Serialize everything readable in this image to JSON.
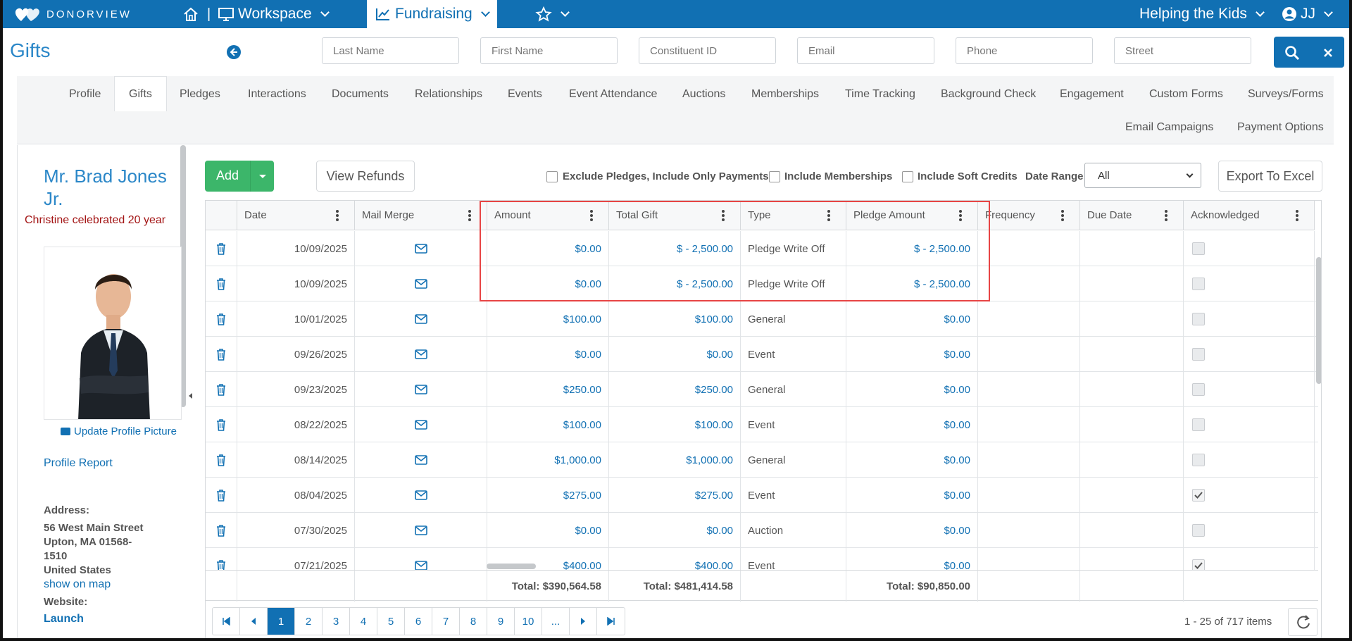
{
  "topbar": {
    "logo_text": "DONORVIEW",
    "workspace_label": "Workspace",
    "fundraising_label": "Fundraising",
    "org_label": "Helping the Kids",
    "user_initials": "JJ",
    "icons": {
      "home": "home-icon",
      "workspace": "monitor-icon",
      "fundraising": "trend-chart-icon",
      "favorites": "star-icon",
      "user": "user-circle-icon"
    }
  },
  "page": {
    "title": "Gifts"
  },
  "search": {
    "last_name": "Last Name",
    "first_name": "First Name",
    "constituent_id": "Constituent ID",
    "email": "Email",
    "phone": "Phone",
    "street": "Street"
  },
  "tabs": [
    "Profile",
    "Gifts",
    "Pledges",
    "Interactions",
    "Documents",
    "Relationships",
    "Events",
    "Event Attendance",
    "Auctions",
    "Memberships",
    "Time Tracking",
    "Background Check",
    "Engagement",
    "Custom Forms",
    "Surveys/Forms",
    "Email Campaigns",
    "Payment Options"
  ],
  "selected_tab": "Gifts",
  "profile": {
    "name_line1": "Mr. Brad Jones",
    "name_line2": "Jr.",
    "message": "Christine celebrated 20 year",
    "update_picture": "Update Profile Picture",
    "profile_report": "Profile Report",
    "address_label": "Address:",
    "address_line1": "56 West Main Street",
    "address_line2": "Upton, MA 01568-",
    "address_line3": "1510",
    "address_line4": "United States",
    "show_on_map": "show on map",
    "website_label": "Website:",
    "website_link": "Launch"
  },
  "toolbar": {
    "add": "Add",
    "view_refunds": "View Refunds",
    "exclude_pledges": "Exclude Pledges, Include Only Payments",
    "include_memberships": "Include Memberships",
    "include_soft_credits": "Include Soft Credits",
    "date_range_label": "Date Range",
    "date_range_value": "All",
    "export": "Export To Excel"
  },
  "grid": {
    "headers": [
      "Date",
      "Mail Merge",
      "Amount",
      "Total Gift",
      "Type",
      "Pledge Amount",
      "Frequency",
      "Due Date",
      "Acknowledged"
    ],
    "rows": [
      {
        "date": "10/09/2025",
        "amount": "$0.00",
        "total": "$ - 2,500.00",
        "type": "Pledge Write Off",
        "pledge": "$ - 2,500.00",
        "ack": false
      },
      {
        "date": "10/09/2025",
        "amount": "$0.00",
        "total": "$ - 2,500.00",
        "type": "Pledge Write Off",
        "pledge": "$ - 2,500.00",
        "ack": false
      },
      {
        "date": "10/01/2025",
        "amount": "$100.00",
        "total": "$100.00",
        "type": "General",
        "pledge": "$0.00",
        "ack": false
      },
      {
        "date": "09/26/2025",
        "amount": "$0.00",
        "total": "$0.00",
        "type": "Event",
        "pledge": "$0.00",
        "ack": false
      },
      {
        "date": "09/23/2025",
        "amount": "$250.00",
        "total": "$250.00",
        "type": "General",
        "pledge": "$0.00",
        "ack": false
      },
      {
        "date": "08/22/2025",
        "amount": "$100.00",
        "total": "$100.00",
        "type": "Event",
        "pledge": "$0.00",
        "ack": false
      },
      {
        "date": "08/14/2025",
        "amount": "$1,000.00",
        "total": "$1,000.00",
        "type": "General",
        "pledge": "$0.00",
        "ack": false
      },
      {
        "date": "08/04/2025",
        "amount": "$275.00",
        "total": "$275.00",
        "type": "Event",
        "pledge": "$0.00",
        "ack": true
      },
      {
        "date": "07/30/2025",
        "amount": "$0.00",
        "total": "$0.00",
        "type": "Auction",
        "pledge": "$0.00",
        "ack": false
      },
      {
        "date": "07/21/2025",
        "amount": "$400.00",
        "total": "$400.00",
        "type": "Event",
        "pledge": "$0.00",
        "ack": true
      }
    ],
    "totals": {
      "amount": "Total: $390,564.58",
      "total_gift": "Total: $481,414.58",
      "pledge_amount": "Total: $90,850.00"
    }
  },
  "pager": {
    "pages": [
      "1",
      "2",
      "3",
      "4",
      "5",
      "6",
      "7",
      "8",
      "9",
      "10",
      "..."
    ],
    "current": "1",
    "info": "1 - 25 of 717 items"
  },
  "colors": {
    "brand": "#1170b3",
    "add_button": "#3cb66a",
    "highlight": "#e74545",
    "message": "#a31515"
  }
}
